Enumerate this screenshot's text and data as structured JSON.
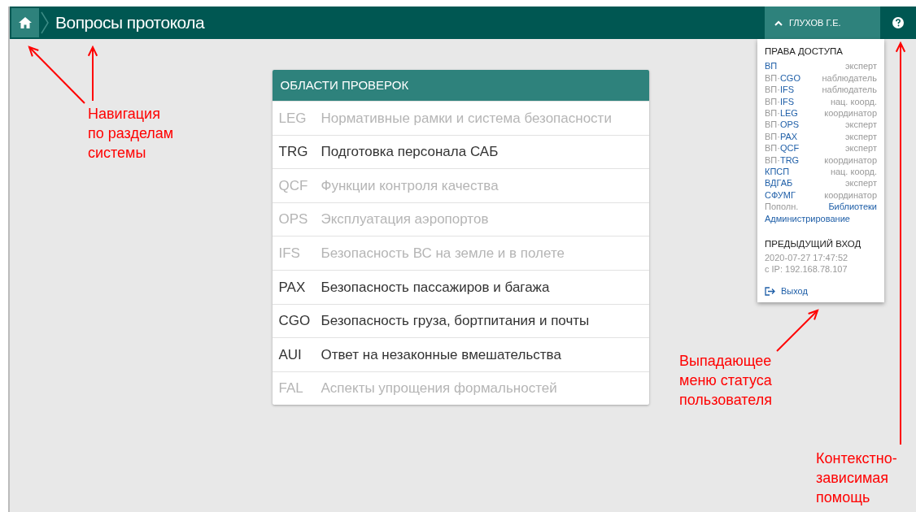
{
  "header": {
    "title": "Вопросы протокола",
    "user": "ГЛУХОВ Г.Е.",
    "user_menu_expanded": true
  },
  "areas": {
    "title": "ОБЛАСТИ ПРОВЕРОК",
    "rows": [
      {
        "code": "LEG",
        "name": "Нормативные рамки и система безопасности",
        "disabled": true
      },
      {
        "code": "TRG",
        "name": "Подготовка персонала САБ",
        "disabled": false
      },
      {
        "code": "QCF",
        "name": "Функции контроля качества",
        "disabled": true
      },
      {
        "code": "OPS",
        "name": "Эксплуатация аэропортов",
        "disabled": true
      },
      {
        "code": "IFS",
        "name": "Безопасность ВС на земле и в полете",
        "disabled": true
      },
      {
        "code": "PAX",
        "name": "Безопасность пассажиров и багажа",
        "disabled": false
      },
      {
        "code": "CGO",
        "name": "Безопасность груза, бортпитания и почты",
        "disabled": false
      },
      {
        "code": "AUI",
        "name": "Ответ на незаконные вмешательства",
        "disabled": false
      },
      {
        "code": "FAL",
        "name": "Аспекты упрощения формальностей",
        "disabled": true
      }
    ]
  },
  "user_menu": {
    "rights_title": "ПРАВА ДОСТУПА",
    "rights": [
      {
        "left": [
          {
            "text": "ВП",
            "link": true
          }
        ],
        "right": {
          "text": "эксперт",
          "link": false
        }
      },
      {
        "left": [
          {
            "text": "ВП·",
            "link": false
          },
          {
            "text": "CGO",
            "link": true
          }
        ],
        "right": {
          "text": "наблюдатель",
          "link": false
        }
      },
      {
        "left": [
          {
            "text": "ВП·",
            "link": false
          },
          {
            "text": "IFS",
            "link": true
          }
        ],
        "right": {
          "text": "наблюдатель",
          "link": false
        }
      },
      {
        "left": [
          {
            "text": "ВП·",
            "link": false
          },
          {
            "text": "IFS",
            "link": true
          }
        ],
        "right": {
          "text": "нац. коорд.",
          "link": false
        }
      },
      {
        "left": [
          {
            "text": "ВП·",
            "link": false
          },
          {
            "text": "LEG",
            "link": true
          }
        ],
        "right": {
          "text": "координатор",
          "link": false
        }
      },
      {
        "left": [
          {
            "text": "ВП·",
            "link": false
          },
          {
            "text": "OPS",
            "link": true
          }
        ],
        "right": {
          "text": "эксперт",
          "link": false
        }
      },
      {
        "left": [
          {
            "text": "ВП·",
            "link": false
          },
          {
            "text": "PAX",
            "link": true
          }
        ],
        "right": {
          "text": "эксперт",
          "link": false
        }
      },
      {
        "left": [
          {
            "text": "ВП·",
            "link": false
          },
          {
            "text": "QCF",
            "link": true
          }
        ],
        "right": {
          "text": "эксперт",
          "link": false
        }
      },
      {
        "left": [
          {
            "text": "ВП·",
            "link": false
          },
          {
            "text": "TRG",
            "link": true
          }
        ],
        "right": {
          "text": "координатор",
          "link": false
        }
      },
      {
        "left": [
          {
            "text": "КПСП",
            "link": true
          }
        ],
        "right": {
          "text": "нац. коорд.",
          "link": false
        }
      },
      {
        "left": [
          {
            "text": "ВДГАБ",
            "link": true
          }
        ],
        "right": {
          "text": "эксперт",
          "link": false
        }
      },
      {
        "left": [
          {
            "text": "СФУМГ",
            "link": true
          }
        ],
        "right": {
          "text": "координатор",
          "link": false
        }
      },
      {
        "left": [
          {
            "text": "Пополн.",
            "link": false
          }
        ],
        "right": {
          "text": "Библиотеки",
          "link": true
        }
      },
      {
        "left": [
          {
            "text": "Администрирование",
            "link": true
          }
        ]
      }
    ],
    "last_login_title": "ПРЕДЫДУЩИЙ ВХОД",
    "last_login": [
      "2020-07-27 17:47:52",
      "с IP: 192.168.78.107"
    ],
    "logout": "Выход"
  },
  "annotations": [
    {
      "text": [
        "Навигация",
        "по разделам",
        "системы"
      ]
    },
    {
      "text": [
        "Выпадающее",
        "меню статуса",
        "пользователя"
      ]
    },
    {
      "text": [
        "Контекстно-",
        "зависимая",
        "помощь"
      ]
    }
  ]
}
